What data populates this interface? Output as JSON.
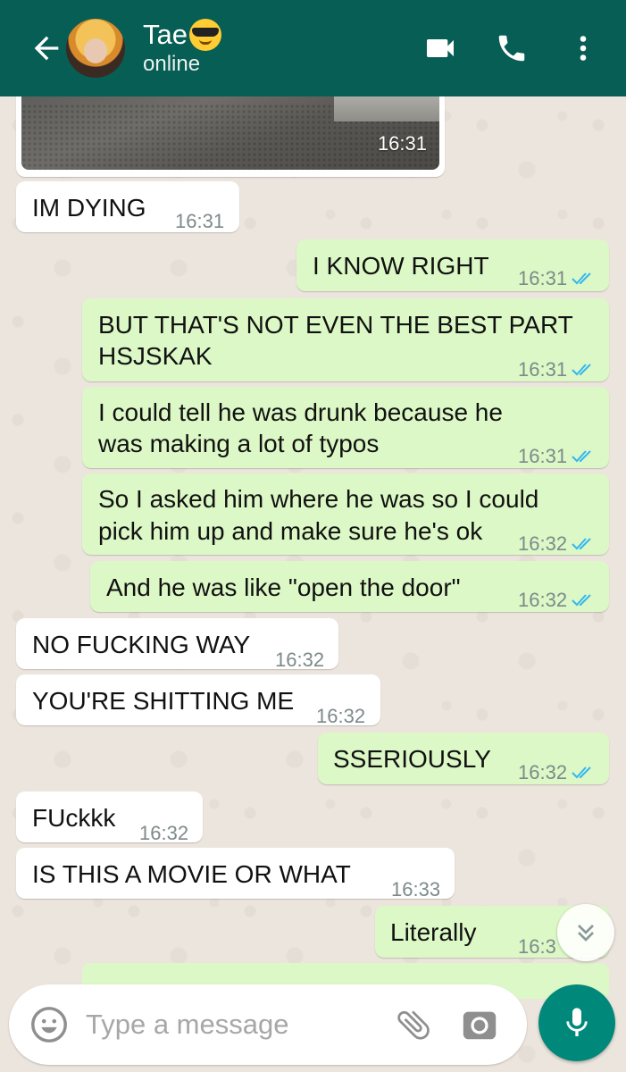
{
  "header": {
    "contact_name": "Tae",
    "status": "online",
    "colors": {
      "bar": "#075e54",
      "incoming": "#ffffff",
      "outgoing": "#dcf8c6",
      "tick": "#34b7f1"
    }
  },
  "image_message": {
    "time": "16:31"
  },
  "messages": [
    {
      "dir": "in",
      "text": "IM DYING",
      "time": "16:31"
    },
    {
      "dir": "out",
      "text": "I KNOW RIGHT",
      "time": "16:31",
      "status": "read"
    },
    {
      "dir": "out",
      "line1": "BUT THAT'S NOT EVEN THE BEST PART",
      "line2": "HSJSKAK",
      "time": "16:31",
      "status": "read"
    },
    {
      "dir": "out",
      "line1": "I could tell he was drunk because he",
      "line2": "was making a lot of typos",
      "time": "16:31",
      "status": "read"
    },
    {
      "dir": "out",
      "line1": "So I asked him where he was so I could",
      "line2": "pick him up and make sure he's ok",
      "time": "16:32",
      "status": "read"
    },
    {
      "dir": "out",
      "text": "And he was like \"open the door\"",
      "time": "16:32",
      "status": "read"
    },
    {
      "dir": "in",
      "text": "NO FUCKING WAY",
      "time": "16:32"
    },
    {
      "dir": "in",
      "text": "YOU'RE SHITTING ME",
      "time": "16:32"
    },
    {
      "dir": "out",
      "text": "SSERIOUSLY",
      "time": "16:32",
      "status": "read"
    },
    {
      "dir": "in",
      "text": "FUckkk",
      "time": "16:32"
    },
    {
      "dir": "in",
      "text": "IS THIS A MOVIE OR WHAT",
      "time": "16:33"
    },
    {
      "dir": "out",
      "text": "Literally",
      "time": "16:3"
    }
  ],
  "composer": {
    "placeholder": "Type a message"
  },
  "icons": {
    "back": "arrow-left-icon",
    "video": "video-camera-icon",
    "call": "phone-icon",
    "menu": "more-vert-icon",
    "emoji": "smiley-icon",
    "attach": "paperclip-icon",
    "camera": "camera-icon",
    "mic": "microphone-icon",
    "scroll": "double-chevron-down-icon"
  }
}
